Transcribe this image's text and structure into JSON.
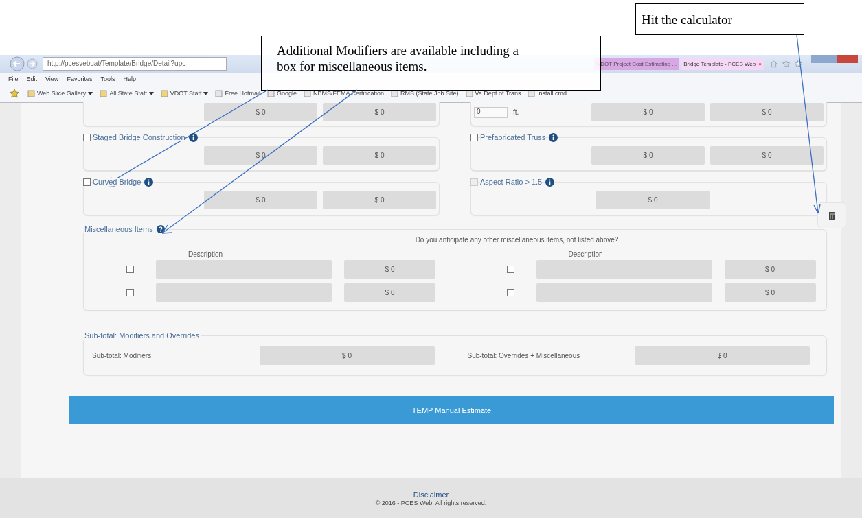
{
  "annotations": [
    {
      "text": "Hit the calculator"
    },
    {
      "text": "Additional Modifiers are available including a box for miscellaneous items."
    }
  ],
  "browser": {
    "address": "http://pcesvebuat/Template/Bridge/Detail?upc=",
    "tabs": [
      {
        "label": "VDOT Project Cost Estimating ...",
        "selected": false
      },
      {
        "label": "Bridge Template - PCES Web",
        "selected": true,
        "close": "×"
      }
    ],
    "menu": [
      "File",
      "Edit",
      "View",
      "Favorites",
      "Tools",
      "Help"
    ],
    "favorites": [
      {
        "label": "Web Slice Gallery",
        "dropdown": true
      },
      {
        "label": "All State Staff",
        "dropdown": true
      },
      {
        "label": "VDOT Staff",
        "dropdown": true
      },
      {
        "label": "Free Hotmail",
        "dropdown": false
      },
      {
        "label": "Google",
        "dropdown": false
      },
      {
        "label": "NBMS/FEMA Certification",
        "dropdown": false
      },
      {
        "label": "RMS (State Job Site)",
        "dropdown": false
      },
      {
        "label": "Va Dept of Trans",
        "dropdown": false
      },
      {
        "label": "install.cmd",
        "dropdown": false
      }
    ]
  },
  "modifiers": {
    "columns": [
      [
        {
          "kind": "partial",
          "values": [
            "$ 0",
            "$ 0"
          ]
        },
        {
          "kind": "card",
          "label": "Staged Bridge Construction",
          "checked": false,
          "disabled": false,
          "values": [
            "$ 0",
            "$ 0"
          ]
        },
        {
          "kind": "card",
          "label": "Curved Bridge",
          "checked": false,
          "disabled": false,
          "values": [
            "$ 0",
            "$ 0"
          ]
        }
      ],
      [
        {
          "kind": "partial",
          "input": "0",
          "unit": "ft.",
          "values": [
            "$ 0",
            "$ 0"
          ]
        },
        {
          "kind": "card",
          "label": "Prefabricated Truss",
          "checked": false,
          "disabled": false,
          "values": [
            "$ 0",
            "$ 0"
          ]
        },
        {
          "kind": "card",
          "label": "Aspect Ratio > 1.5",
          "checked": false,
          "disabled": true,
          "values": [
            "$ 0"
          ]
        }
      ]
    ]
  },
  "misc": {
    "title": "Miscellaneous Items",
    "question": "Do you anticipate any other miscellaneous items, not listed above?",
    "columns": [
      {
        "header": "Description",
        "rows": [
          {
            "checked": false,
            "amount": "$ 0"
          },
          {
            "checked": false,
            "amount": "$ 0"
          }
        ]
      },
      {
        "header": "Description",
        "rows": [
          {
            "checked": false,
            "amount": "$ 0"
          },
          {
            "checked": false,
            "amount": "$ 0"
          }
        ]
      }
    ]
  },
  "subtotal": {
    "title": "Sub-total: Modifiers and Overrides",
    "items": [
      {
        "label": "Sub-total: Modifiers",
        "value": "$ 0"
      },
      {
        "label": "Sub-total: Overrides + Miscellaneous",
        "value": "$ 0"
      }
    ]
  },
  "action": "TEMP Manual Estimate",
  "footer": {
    "link": "Disclaimer",
    "copyright": "© 2016 - PCES Web. All rights reserved."
  }
}
